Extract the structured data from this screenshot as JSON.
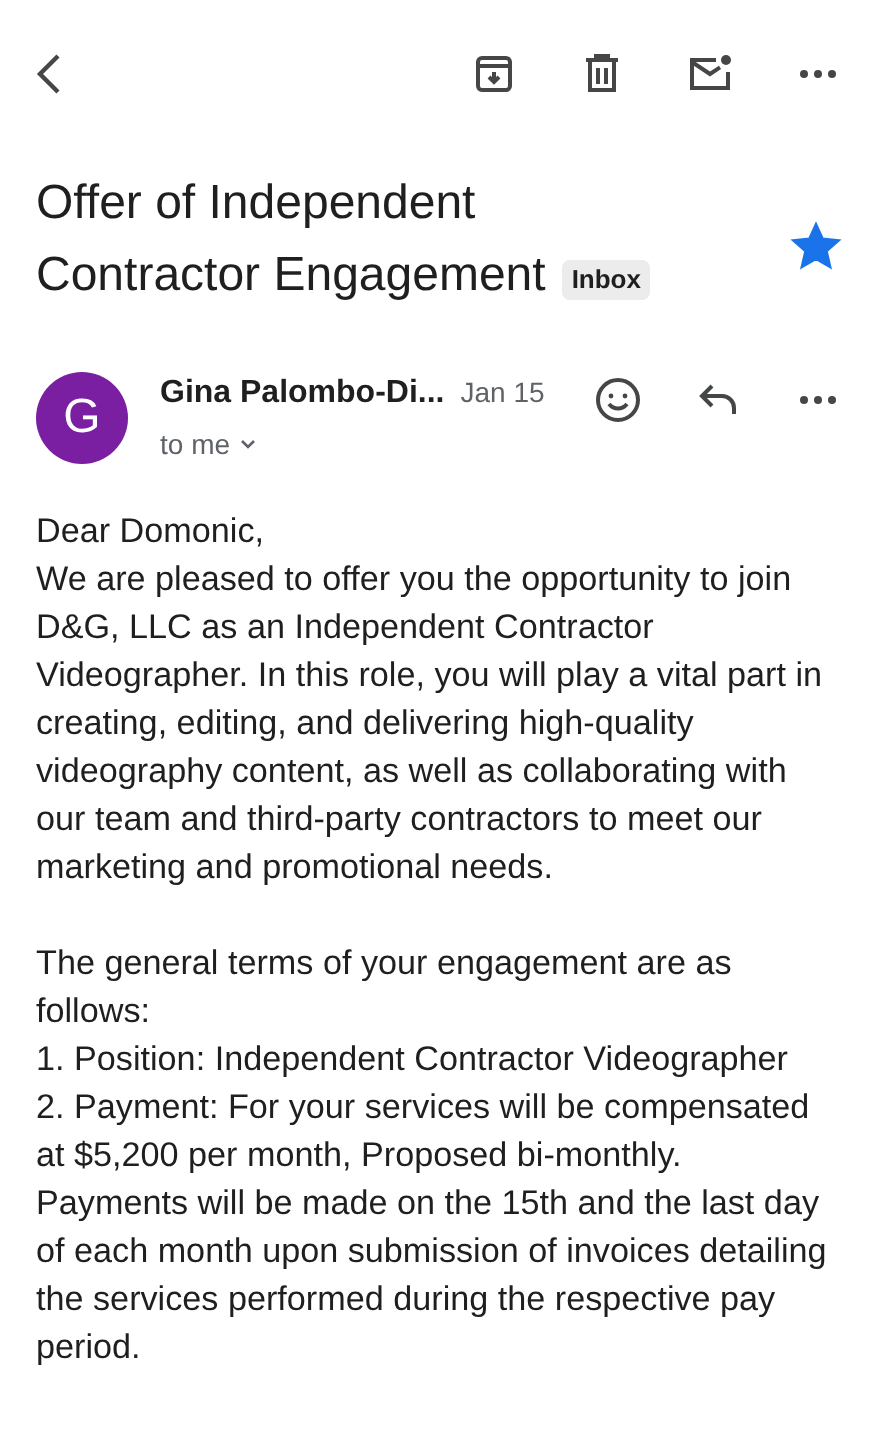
{
  "toolbar": {
    "actions": [
      {
        "kind": "archive"
      },
      {
        "kind": "delete"
      },
      {
        "kind": "unread"
      },
      {
        "kind": "more"
      }
    ]
  },
  "subject": {
    "title_lines": [
      "Offer of Independent",
      "Contractor Engagement"
    ],
    "label": "Inbox",
    "starred": true
  },
  "message": {
    "avatar": "G",
    "sender": "Gina Palombo-Di...",
    "date": "Jan 15",
    "recipient": "to me"
  },
  "body": [
    {
      "lines": [
        "Dear Domonic,",
        "We are pleased to offer you the opportunity to join D&G, LLC as an Independent Contractor Videographer. In this role, you will play a vital part in creating, editing, and delivering high-quality videography content, as well as collaborating with our team and third-party contractors to meet our marketing and promotional needs."
      ]
    },
    {
      "lines": [
        "The general terms of your engagement are as follows:",
        "1. Position: Independent Contractor Videographer",
        "2. Payment: For your services will be compensated at $5,200 per month, Proposed bi-monthly. Payments will be made on the 15th and the last day of each month upon submission of invoices detailing the services performed during the respective pay period."
      ]
    }
  ]
}
